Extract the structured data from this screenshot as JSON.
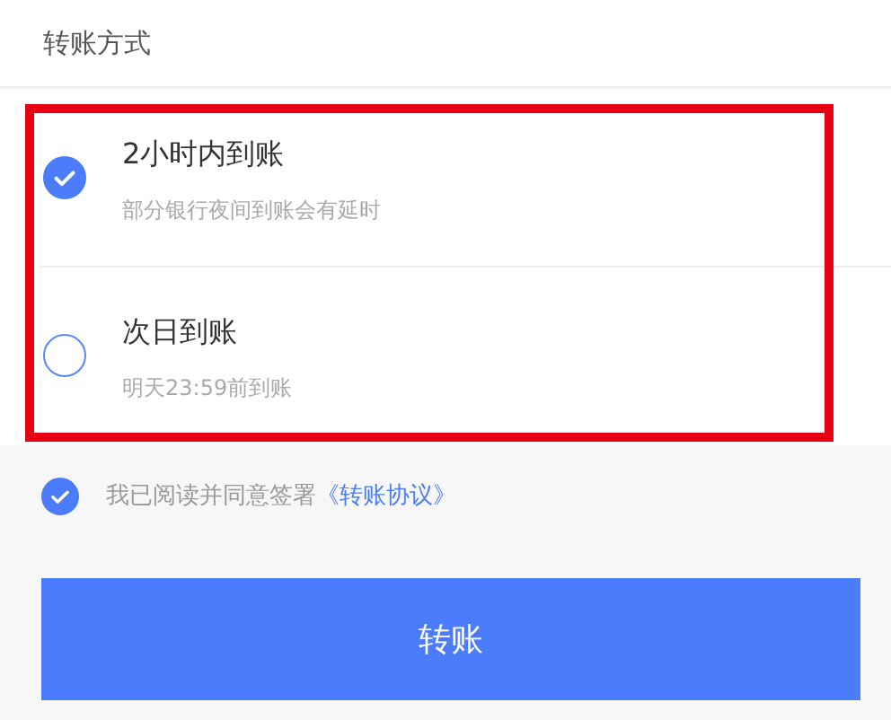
{
  "section_title": "转账方式",
  "options": [
    {
      "title": "2小时内到账",
      "note": "部分银行夜间到账会有延时",
      "selected": true
    },
    {
      "title": "次日到账",
      "note": "明天23:59前到账",
      "selected": false
    }
  ],
  "agreement": {
    "checked": true,
    "text": "我已阅读并同意签署",
    "link": "《转账协议》"
  },
  "submit_button": "转账"
}
